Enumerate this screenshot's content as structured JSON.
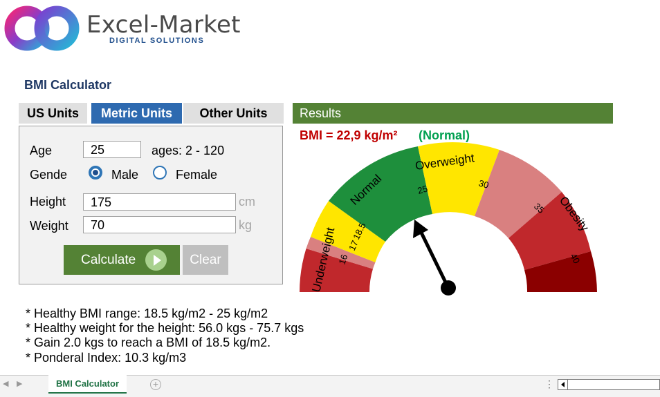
{
  "brand": {
    "name": "Excel-Market",
    "tagline": "DIGITAL SOLUTIONS"
  },
  "app": {
    "title": "BMI Calculator"
  },
  "tabs": [
    {
      "label": "US Units",
      "active": false
    },
    {
      "label": "Metric Units",
      "active": true
    },
    {
      "label": "Other Units",
      "active": false
    }
  ],
  "form": {
    "age": {
      "label": "Age",
      "value": "25",
      "hint": "ages: 2 - 120"
    },
    "gender": {
      "label": "Gende",
      "options": [
        "Male",
        "Female"
      ],
      "selected": "Male"
    },
    "height": {
      "label": "Height",
      "value": "175",
      "unit": "cm"
    },
    "weight": {
      "label": "Weight",
      "value": "70",
      "unit": "kg"
    },
    "calculate_label": "Calculate",
    "clear_label": "Clear"
  },
  "results": {
    "header": "Results",
    "bmi_text": "BMI = 22,9 kg/m²",
    "classification": "(Normal)",
    "bmi_value": 22.9
  },
  "gauge": {
    "categories": [
      {
        "label": "Underweight",
        "color": "#c0282c"
      },
      {
        "label": "Normal",
        "color": "#1e8f3c"
      },
      {
        "label": "Overweight",
        "color": "#ffe600"
      },
      {
        "label": "Obesity",
        "color": "#c0282c"
      }
    ],
    "tick_labels": [
      "16",
      "17",
      "18.5",
      "25",
      "30",
      "35",
      "40"
    ]
  },
  "notes": [
    "* Healthy BMI range: 18.5 kg/m2 - 25 kg/m2",
    "* Healthy weight for the height: 56.0 kgs - 75.7 kgs",
    "* Gain 2.0 kgs to reach a BMI of 18.5 kg/m2.",
    "* Ponderal Index: 10.3 kg/m3"
  ],
  "sheet": {
    "tab_label": "BMI Calculator"
  },
  "colors": {
    "accent_green": "#548235",
    "tab_blue": "#2e6ab0",
    "bmi_red": "#c00000",
    "normal_green": "#00a050"
  },
  "icons": [
    "logo-mark-icon",
    "play-icon",
    "add-sheet-icon",
    "scroll-left-icon"
  ]
}
